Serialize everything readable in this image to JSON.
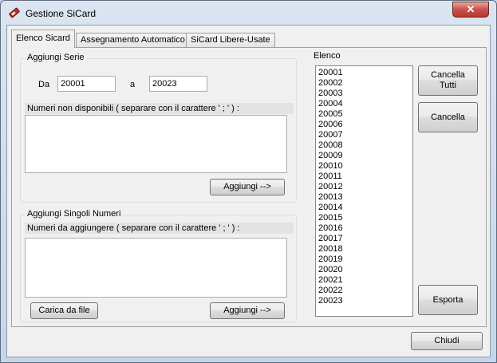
{
  "window": {
    "title": "Gestione SiCard",
    "close_glyph": "✕"
  },
  "tabs": [
    {
      "label": "Elenco Sicard",
      "active": true
    },
    {
      "label": "Assegnamento Automatico",
      "active": false
    },
    {
      "label": "SiCard Libere-Usate",
      "active": false
    }
  ],
  "serie": {
    "legend": "Aggiungi Serie",
    "from_label": "Da",
    "from_value": "20001",
    "to_label": "a",
    "to_value": "20023",
    "unavailable_label": "Numeri non disponibili ( separare con il carattere ' ; ' ) :",
    "unavailable_value": "",
    "add_button": "Aggiungi -->"
  },
  "singoli": {
    "legend": "Aggiungi Singoli Numeri",
    "numbers_label": "Numeri da aggiungere ( separare con il carattere ' ; ' ) :",
    "numbers_value": "",
    "load_button": "Carica da file",
    "add_button": "Aggiungi -->"
  },
  "elenco": {
    "label": "Elenco",
    "items": [
      "20001",
      "20002",
      "20003",
      "20004",
      "20005",
      "20006",
      "20007",
      "20008",
      "20009",
      "20010",
      "20011",
      "20012",
      "20013",
      "20014",
      "20015",
      "20016",
      "20017",
      "20018",
      "20019",
      "20020",
      "20021",
      "20022",
      "20023"
    ]
  },
  "actions": {
    "clear_all_line1": "Cancella",
    "clear_all_line2": "Tutti",
    "delete": "Cancella",
    "export": "Esporta",
    "close": "Chiudi"
  },
  "colors": {
    "close_button": "#c75050",
    "client_bg": "#f0f0f0"
  }
}
